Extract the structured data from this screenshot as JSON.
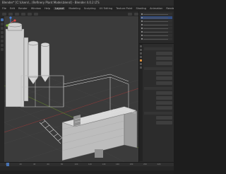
{
  "window": {
    "title": "Blender* [C:\\Users\\...\\Refinery Plant Model.blend] - Blender 4.0.2 LTS"
  },
  "menu": {
    "items": [
      "File",
      "Edit",
      "Render",
      "Window",
      "Help",
      "Layout",
      "Modeling",
      "Sculpting",
      "UV Editing",
      "Texture Paint",
      "Shading",
      "Animation",
      "Rendering",
      "Compositing",
      "Geometry Nodes",
      "Scripting"
    ],
    "active_index": 5
  },
  "viewport": {
    "background": "#3b3b3b"
  },
  "timeline": {
    "ticks": [
      "0",
      "20",
      "40",
      "60",
      "80",
      "100",
      "120",
      "140",
      "160",
      "180",
      "200",
      "220"
    ]
  },
  "colors": {
    "accent": "#4772b3",
    "properties_tab_active": "#d88d3a"
  }
}
